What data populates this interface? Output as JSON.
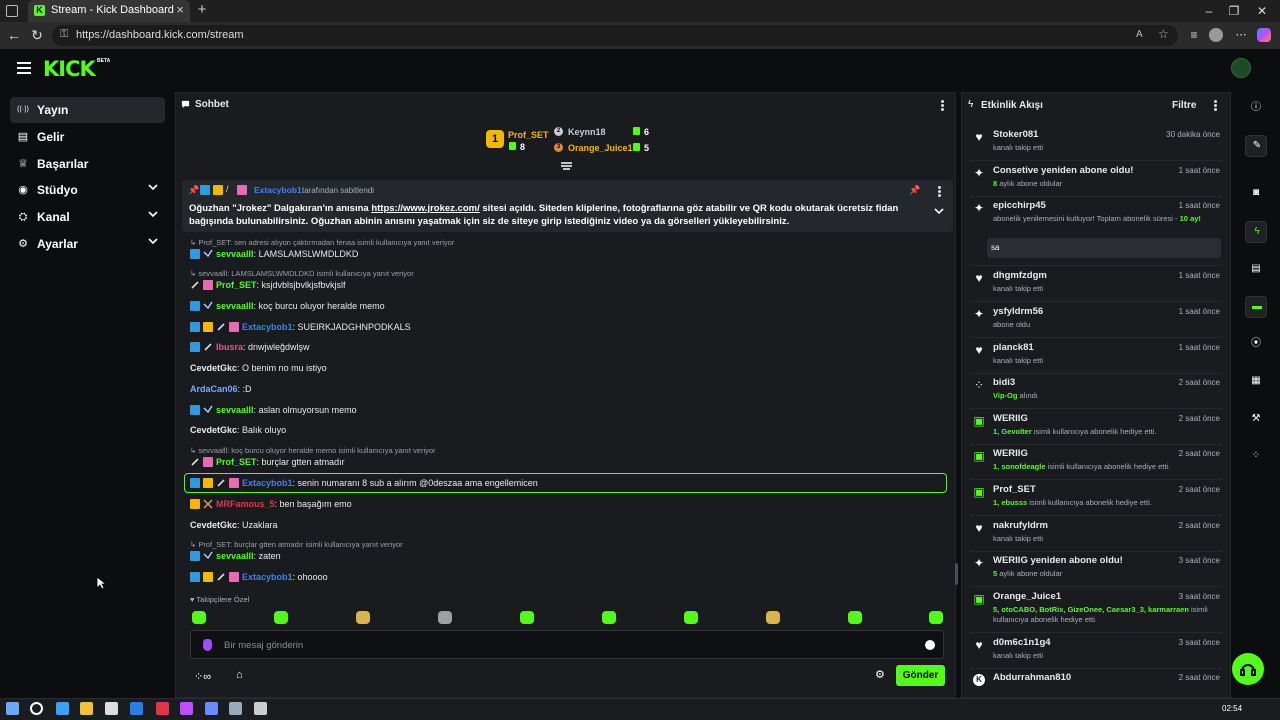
{
  "browser": {
    "tab_title": "Stream - Kick Dashboard",
    "url": "https://dashboard.kick.com/stream"
  },
  "app": {
    "logo": "KICK",
    "beta": "BETA"
  },
  "sidebar": {
    "items": [
      {
        "label": "Yayın",
        "icon": "broadcast-icon",
        "active": true
      },
      {
        "label": "Gelir",
        "icon": "revenue-icon"
      },
      {
        "label": "Başarılar",
        "icon": "trophy-icon"
      },
      {
        "label": "Stüdyo",
        "icon": "studio-icon",
        "expandable": true
      },
      {
        "label": "Kanal",
        "icon": "channel-icon",
        "expandable": true
      },
      {
        "label": "Ayarlar",
        "icon": "gear-icon",
        "expandable": true
      }
    ]
  },
  "chat": {
    "title": "Sohbet",
    "leaderboard": [
      {
        "name": "Prof_SET",
        "count": "8",
        "rank": "1",
        "color": "#f5b700"
      },
      {
        "name": "Keynn18",
        "count": "6",
        "rank": "2",
        "color": "#c8ccd0"
      },
      {
        "name": "Orange_Juice1",
        "count": "5",
        "rank": "3",
        "color": "#e0883a"
      }
    ],
    "pinned": {
      "by_user": "Extacybob1",
      "by_suffix": "tarafından sabitlendi",
      "text_before": "Oğuzhan \"Jrokez\" Dalgakıran'ın anısına",
      "link": "https://www.jrokez.com/",
      "text_after": "sitesi açıldı. Siteden kliplerine, fotoğraflarına göz atabilir ve QR kodu okutarak ücretsiz fidan",
      "text_line2": "bağışında bulunabilirsiniz. Oğuzhan abinin anısını yaşatmak için siz de siteye girip istediğiniz video ya da görselleri yükleyebilirsiniz."
    },
    "messages": [
      {
        "reply": "Prof_SET: sen adresi alıyon çaktırmadan fenaa isimli kullanıcıya yanıt veriyor",
        "badges": [
          "mod",
          "sword"
        ],
        "user": "sevvaalll",
        "color": "#53fc18",
        "text": "LAMSLAMSLWMDLDKD"
      },
      {
        "reply": "sevvaalll: LAMSLAMSLWMDLDKD isimli kullanıcıya yanıt veriyor",
        "badges": [
          "pen",
          "sub"
        ],
        "user": "Prof_SET",
        "color": "#53fc18",
        "text": "ksjdvblsjbvlkjsfbvkjslf"
      },
      {
        "badges": [
          "mod",
          "sword"
        ],
        "user": "sevvaalll",
        "color": "#53fc18",
        "text": "koç burcu oluyor heralde memo"
      },
      {
        "badges": [
          "mod",
          "vip",
          "pen",
          "sub"
        ],
        "user": "Extacybob1",
        "color": "#3b82f6",
        "text": "SUEIRKJADGHNPODKALS"
      },
      {
        "badges": [
          "mod",
          "pen"
        ],
        "user": "Ibusra",
        "color": "#e05a8a",
        "text": "dnwjwleğdwlşw"
      },
      {
        "badges": [],
        "user": "CevdetGkc",
        "color": "#e8eaea",
        "text": "O benim no mu istiyo"
      },
      {
        "badges": [],
        "user": "ArdaCan06",
        "color": "#7aa7ff",
        "text": ":D"
      },
      {
        "badges": [
          "mod",
          "sword"
        ],
        "user": "sevvaalll",
        "color": "#53fc18",
        "text": "aslan olmuyorsun memo"
      },
      {
        "badges": [],
        "user": "CevdetGkc",
        "color": "#e8eaea",
        "text": "Balık oluyo"
      },
      {
        "reply": "sevvaalll: koç burcu oluyor heralde memo isimli kullanıcıya yanıt veriyor",
        "badges": [
          "pen",
          "sub"
        ],
        "user": "Prof_SET",
        "color": "#53fc18",
        "text": "burçlar gtten atmadır"
      },
      {
        "badges": [
          "mod",
          "vip",
          "pen",
          "sub"
        ],
        "user": "Extacybob1",
        "color": "#3b82f6",
        "text": "senin numaranı 8 sub a alırım @0deszaa ama engellemicen",
        "highlight": true
      },
      {
        "badges": [
          "vip",
          "sword2"
        ],
        "user": "MRFamous_5",
        "color": "#e0364a",
        "text": "ben başağım emo"
      },
      {
        "badges": [],
        "user": "CevdetGkc",
        "color": "#e8eaea",
        "text": "Uzaklara"
      },
      {
        "reply": "Prof_SET: burçlar gtten atmadır isimli kullanıcıya yanıt veriyor",
        "badges": [
          "mod",
          "sword"
        ],
        "user": "sevvaalll",
        "color": "#53fc18",
        "text": "zaten"
      },
      {
        "badges": [
          "mod",
          "vip",
          "pen",
          "sub"
        ],
        "user": "Extacybob1",
        "color": "#3b82f6",
        "text": "ohoooo"
      }
    ],
    "followers_only": "Takipçilere Özel",
    "input_placeholder": "Bir mesaj gönderin",
    "send_label": "Gönder"
  },
  "activity": {
    "title": "Etkinlik Akışı",
    "filter_label": "Filtre",
    "items": [
      {
        "icon": "heart-icon",
        "name": "Stoker081",
        "time": "30 dakika önce",
        "desc": "kanalı takip etti"
      },
      {
        "icon": "star-icon",
        "name": "Consetive yeniden abone oldu!",
        "time": "1 saat önce",
        "desc_strong": "8",
        "desc": "aylık abone oldular"
      },
      {
        "icon": "star-icon",
        "name": "epicchirp45",
        "time": "1 saat önce",
        "desc": "abonelik yenilemesini kutluyor! Toplam abonelik süresi -",
        "desc_strong": "10 ay!",
        "note": "sa"
      },
      {
        "icon": "heart-icon",
        "name": "dhgmfzdgm",
        "time": "1 saat önce",
        "desc": "kanalı takip etti"
      },
      {
        "icon": "star-icon",
        "name": "ysfyldrm56",
        "time": "1 saat önce",
        "desc": "abone oldu"
      },
      {
        "icon": "heart-icon",
        "name": "planck81",
        "time": "1 saat önce",
        "desc": "kanalı takip etti"
      },
      {
        "icon": "kicks-icon",
        "name": "bidi3",
        "time": "2 saat önce",
        "desc_strong": "Vip-Og",
        "desc": "alındı"
      },
      {
        "icon": "gift-icon",
        "name": "WERIIG",
        "time": "2 saat önce",
        "desc_strong": "1, Gevolter",
        "desc": "isimli kullanıcıya abonelik hediye etti."
      },
      {
        "icon": "gift-icon",
        "name": "WERIIG",
        "time": "2 saat önce",
        "desc_strong": "1, sonofdeagle",
        "desc": "isimli kullanıcıya abonelik hediye etti."
      },
      {
        "icon": "gift-icon",
        "name": "Prof_SET",
        "time": "2 saat önce",
        "desc_strong": "1, ebusss",
        "desc": "isimli kullanıcıya abonelik hediye etti."
      },
      {
        "icon": "heart-icon",
        "name": "nakrufyldrm",
        "time": "2 saat önce",
        "desc": "kanalı takip etti"
      },
      {
        "icon": "star-icon",
        "name": "WERIIG yeniden abone oldu!",
        "time": "3 saat önce",
        "desc_strong": "5",
        "desc": "aylık abone oldular"
      },
      {
        "icon": "gift-icon",
        "name": "Orange_Juice1",
        "time": "3 saat önce",
        "desc_strong": "5, otoCABO, BotRix, GizeOnee, Caesar3_3, karmarraen",
        "desc": "isimli kullanıcıya abonelik hediye etti."
      },
      {
        "icon": "heart-icon",
        "name": "d0m6c1n1g4",
        "time": "3 saat önce",
        "desc": "kanalı takip etti"
      },
      {
        "icon": "kick-icon",
        "name": "Abdurrahman810",
        "time": "2 saat önce",
        "desc": ""
      }
    ]
  },
  "taskbar": {
    "time": "02:54"
  },
  "colors": {
    "accent": "#53fc18",
    "panel": "#191b1f",
    "bg": "#0b0d0e"
  }
}
